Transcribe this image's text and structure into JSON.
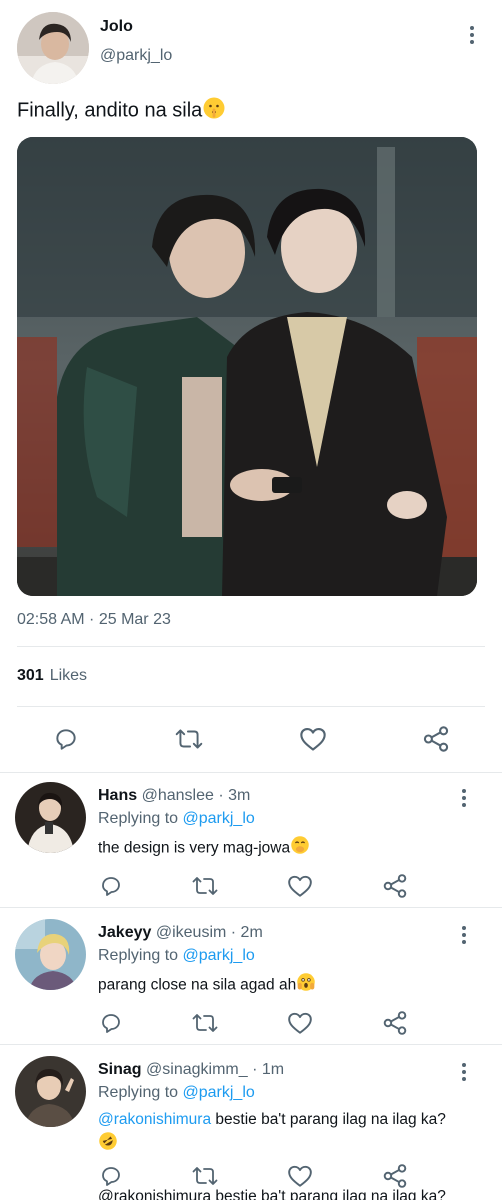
{
  "tweet": {
    "author_name": "Jolo",
    "author_handle": "@parkj_lo",
    "text": "Finally, andito na sila",
    "text_emoji": "shushing-face",
    "timestamp": "02:58 AM · 25 Mar 23",
    "likes_count": "301",
    "likes_label": "Likes"
  },
  "replies": [
    {
      "name": "Hans",
      "handle_time": "@hanslee · 3m",
      "replying_prefix": "Replying to",
      "replying_to": "@parkj_lo",
      "mention": "",
      "text": "the design is very mag-jowa",
      "emoji": "hand-over-mouth-face"
    },
    {
      "name": "Jakeyy",
      "handle_time": "@ikeusim · 2m",
      "replying_prefix": "Replying to",
      "replying_to": "@parkj_lo",
      "mention": "",
      "text": "parang close na sila agad ah",
      "emoji": "screaming-face"
    },
    {
      "name": "Sinag",
      "handle_time": "@sinagkimm_ · 1m",
      "replying_prefix": "Replying to",
      "replying_to": "@parkj_lo",
      "mention": "@rakonishimura",
      "text": " bestie ba't parang ilag na ilag ka?",
      "emoji": "rofl-face"
    }
  ],
  "cut_off_text": "@rakonishimura bestie ba't parang ilag na ilag ka?",
  "colors": {
    "link": "#1d9bf0",
    "secondary_text": "#536471",
    "primary_text": "#0f1419",
    "divider": "#e6e9eb"
  }
}
